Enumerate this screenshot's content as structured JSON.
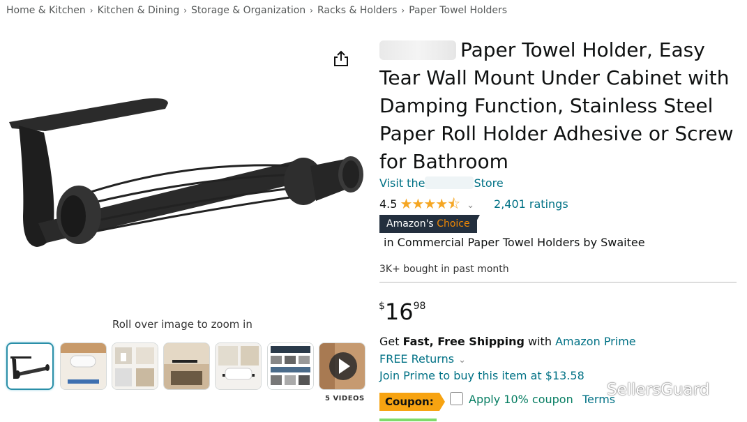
{
  "breadcrumb": [
    "Home & Kitchen",
    "Kitchen & Dining",
    "Storage & Organization",
    "Racks & Holders",
    "Paper Towel Holders"
  ],
  "gallery": {
    "zoom_hint": "Roll over image to zoom in",
    "videos_label": "5 VIDEOS"
  },
  "product": {
    "title": "Paper Towel Holder, Easy Tear Wall Mount Under Cabinet with Damping Function, Stainless Steel Paper Roll Holder Adhesive or Screw for Bathroom",
    "store_prefix": "Visit the",
    "store_suffix": "Store",
    "rating_value": "4.5",
    "stars": "★★★★⯪",
    "ratings_count": "2,401 ratings",
    "badge_prefix": "Amazon's",
    "badge_highlight": "Choice",
    "badge_category": "in Commercial Paper Towel Holders by Swaitee",
    "bought": "3K+ bought in past month",
    "price_currency": "$",
    "price_whole": "16",
    "price_fraction": "98"
  },
  "shipping": {
    "prefix": "Get",
    "bold": "Fast, Free Shipping",
    "middle": "with",
    "prime_link": "Amazon Prime",
    "returns": "FREE Returns",
    "join_prime": "Join Prime to buy this item at $13.58"
  },
  "coupon": {
    "label": "Coupon:",
    "apply_text": "Apply 10% coupon",
    "terms": "Terms",
    "checked": false
  },
  "watermark": "SellersGuard",
  "colors": {
    "link": "#007185",
    "badge_dark": "#232f3e",
    "badge_orange": "#f08804",
    "coupon_orange": "#f7a311",
    "star": "#f5a623",
    "coupon_green": "#067d62"
  }
}
